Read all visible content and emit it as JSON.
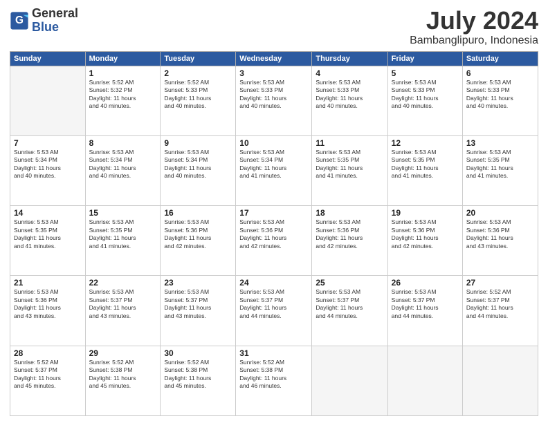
{
  "logo": {
    "line1": "General",
    "line2": "Blue"
  },
  "title": "July 2024",
  "subtitle": "Bambanglipuro, Indonesia",
  "days_of_week": [
    "Sunday",
    "Monday",
    "Tuesday",
    "Wednesday",
    "Thursday",
    "Friday",
    "Saturday"
  ],
  "weeks": [
    [
      {
        "day": "",
        "info": ""
      },
      {
        "day": "1",
        "info": "Sunrise: 5:52 AM\nSunset: 5:32 PM\nDaylight: 11 hours\nand 40 minutes."
      },
      {
        "day": "2",
        "info": "Sunrise: 5:52 AM\nSunset: 5:33 PM\nDaylight: 11 hours\nand 40 minutes."
      },
      {
        "day": "3",
        "info": "Sunrise: 5:53 AM\nSunset: 5:33 PM\nDaylight: 11 hours\nand 40 minutes."
      },
      {
        "day": "4",
        "info": "Sunrise: 5:53 AM\nSunset: 5:33 PM\nDaylight: 11 hours\nand 40 minutes."
      },
      {
        "day": "5",
        "info": "Sunrise: 5:53 AM\nSunset: 5:33 PM\nDaylight: 11 hours\nand 40 minutes."
      },
      {
        "day": "6",
        "info": "Sunrise: 5:53 AM\nSunset: 5:33 PM\nDaylight: 11 hours\nand 40 minutes."
      }
    ],
    [
      {
        "day": "7",
        "info": "Sunrise: 5:53 AM\nSunset: 5:34 PM\nDaylight: 11 hours\nand 40 minutes."
      },
      {
        "day": "8",
        "info": "Sunrise: 5:53 AM\nSunset: 5:34 PM\nDaylight: 11 hours\nand 40 minutes."
      },
      {
        "day": "9",
        "info": "Sunrise: 5:53 AM\nSunset: 5:34 PM\nDaylight: 11 hours\nand 40 minutes."
      },
      {
        "day": "10",
        "info": "Sunrise: 5:53 AM\nSunset: 5:34 PM\nDaylight: 11 hours\nand 41 minutes."
      },
      {
        "day": "11",
        "info": "Sunrise: 5:53 AM\nSunset: 5:35 PM\nDaylight: 11 hours\nand 41 minutes."
      },
      {
        "day": "12",
        "info": "Sunrise: 5:53 AM\nSunset: 5:35 PM\nDaylight: 11 hours\nand 41 minutes."
      },
      {
        "day": "13",
        "info": "Sunrise: 5:53 AM\nSunset: 5:35 PM\nDaylight: 11 hours\nand 41 minutes."
      }
    ],
    [
      {
        "day": "14",
        "info": "Sunrise: 5:53 AM\nSunset: 5:35 PM\nDaylight: 11 hours\nand 41 minutes."
      },
      {
        "day": "15",
        "info": "Sunrise: 5:53 AM\nSunset: 5:35 PM\nDaylight: 11 hours\nand 41 minutes."
      },
      {
        "day": "16",
        "info": "Sunrise: 5:53 AM\nSunset: 5:36 PM\nDaylight: 11 hours\nand 42 minutes."
      },
      {
        "day": "17",
        "info": "Sunrise: 5:53 AM\nSunset: 5:36 PM\nDaylight: 11 hours\nand 42 minutes."
      },
      {
        "day": "18",
        "info": "Sunrise: 5:53 AM\nSunset: 5:36 PM\nDaylight: 11 hours\nand 42 minutes."
      },
      {
        "day": "19",
        "info": "Sunrise: 5:53 AM\nSunset: 5:36 PM\nDaylight: 11 hours\nand 42 minutes."
      },
      {
        "day": "20",
        "info": "Sunrise: 5:53 AM\nSunset: 5:36 PM\nDaylight: 11 hours\nand 43 minutes."
      }
    ],
    [
      {
        "day": "21",
        "info": "Sunrise: 5:53 AM\nSunset: 5:36 PM\nDaylight: 11 hours\nand 43 minutes."
      },
      {
        "day": "22",
        "info": "Sunrise: 5:53 AM\nSunset: 5:37 PM\nDaylight: 11 hours\nand 43 minutes."
      },
      {
        "day": "23",
        "info": "Sunrise: 5:53 AM\nSunset: 5:37 PM\nDaylight: 11 hours\nand 43 minutes."
      },
      {
        "day": "24",
        "info": "Sunrise: 5:53 AM\nSunset: 5:37 PM\nDaylight: 11 hours\nand 44 minutes."
      },
      {
        "day": "25",
        "info": "Sunrise: 5:53 AM\nSunset: 5:37 PM\nDaylight: 11 hours\nand 44 minutes."
      },
      {
        "day": "26",
        "info": "Sunrise: 5:53 AM\nSunset: 5:37 PM\nDaylight: 11 hours\nand 44 minutes."
      },
      {
        "day": "27",
        "info": "Sunrise: 5:52 AM\nSunset: 5:37 PM\nDaylight: 11 hours\nand 44 minutes."
      }
    ],
    [
      {
        "day": "28",
        "info": "Sunrise: 5:52 AM\nSunset: 5:37 PM\nDaylight: 11 hours\nand 45 minutes."
      },
      {
        "day": "29",
        "info": "Sunrise: 5:52 AM\nSunset: 5:38 PM\nDaylight: 11 hours\nand 45 minutes."
      },
      {
        "day": "30",
        "info": "Sunrise: 5:52 AM\nSunset: 5:38 PM\nDaylight: 11 hours\nand 45 minutes."
      },
      {
        "day": "31",
        "info": "Sunrise: 5:52 AM\nSunset: 5:38 PM\nDaylight: 11 hours\nand 46 minutes."
      },
      {
        "day": "",
        "info": ""
      },
      {
        "day": "",
        "info": ""
      },
      {
        "day": "",
        "info": ""
      }
    ]
  ]
}
